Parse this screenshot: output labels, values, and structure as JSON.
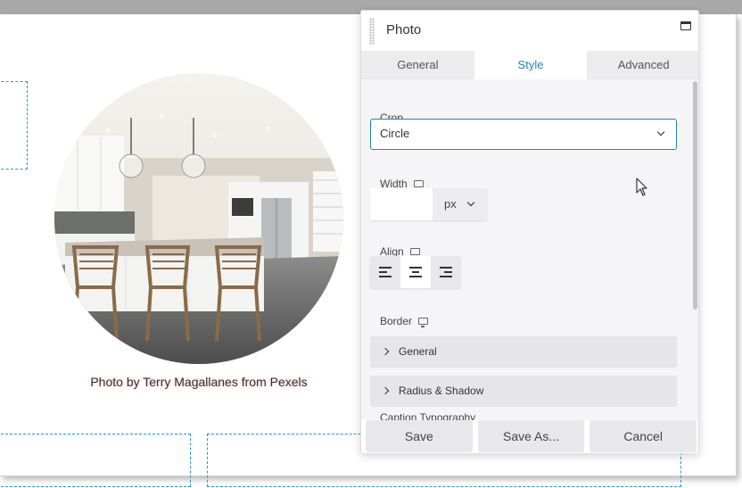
{
  "canvas": {
    "photo_caption": "Photo by Terry Magallanes from Pexels"
  },
  "panel": {
    "title": "Photo",
    "tabs": [
      {
        "label": "General",
        "active": false
      },
      {
        "label": "Style",
        "active": true
      },
      {
        "label": "Advanced",
        "active": false
      }
    ],
    "crop": {
      "label": "Crop",
      "value": "Circle"
    },
    "width": {
      "label": "Width",
      "value": "",
      "unit": "px"
    },
    "align": {
      "label": "Align",
      "options": [
        "left",
        "center",
        "right"
      ],
      "selected": "center"
    },
    "border": {
      "label": "Border"
    },
    "sections": [
      {
        "label": "General"
      },
      {
        "label": "Radius & Shadow"
      }
    ],
    "partial_label": "Caption Typography",
    "footer": {
      "save": "Save",
      "save_as": "Save As...",
      "cancel": "Cancel"
    }
  },
  "colors": {
    "accent": "#1e87b7",
    "dashed_outline": "#1e9bc4",
    "tab_bar": "#ececef",
    "panel_body": "#f5f5f7"
  },
  "icons": [
    "drag-handle-icon",
    "maximize-icon",
    "chevron-down-icon",
    "responsive-monitor-icon",
    "align-left-icon",
    "align-center-icon",
    "align-right-icon",
    "chevron-right-icon",
    "mouse-cursor-icon"
  ]
}
